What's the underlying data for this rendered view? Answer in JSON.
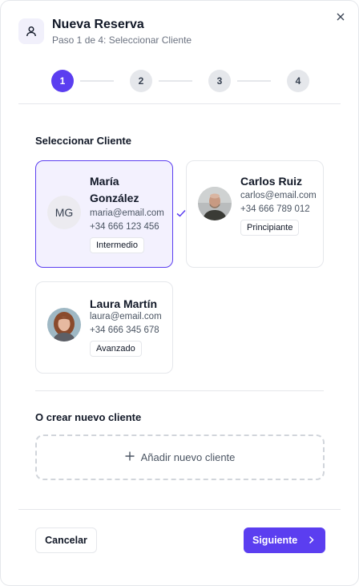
{
  "header": {
    "title": "Nueva Reserva",
    "subtitle": "Paso 1 de 4: Seleccionar Cliente",
    "icon": "user-icon",
    "close_icon": "close-icon"
  },
  "steps": {
    "items": [
      "1",
      "2",
      "3",
      "4"
    ],
    "current": 1
  },
  "select_section": {
    "label": "Seleccionar Cliente",
    "clients": [
      {
        "name": "María González",
        "email": "maria@email.com",
        "phone": "+34 666 123 456",
        "level": "Intermedio",
        "initials": "MG",
        "selected": true
      },
      {
        "name": "Carlos Ruiz",
        "email": "carlos@email.com",
        "phone": "+34 666 789 012",
        "level": "Principiante",
        "selected": false
      },
      {
        "name": "Laura Martín",
        "email": "laura@email.com",
        "phone": "+34 666 345 678",
        "level": "Avanzado",
        "selected": false
      }
    ]
  },
  "new_section": {
    "label": "O crear nuevo cliente",
    "add_label": "Añadir nuevo cliente"
  },
  "footer": {
    "cancel_label": "Cancelar",
    "next_label": "Siguiente"
  },
  "colors": {
    "accent": "#5b3ef0",
    "selected_bg": "#f3f1fe",
    "border": "#e5e7eb"
  }
}
